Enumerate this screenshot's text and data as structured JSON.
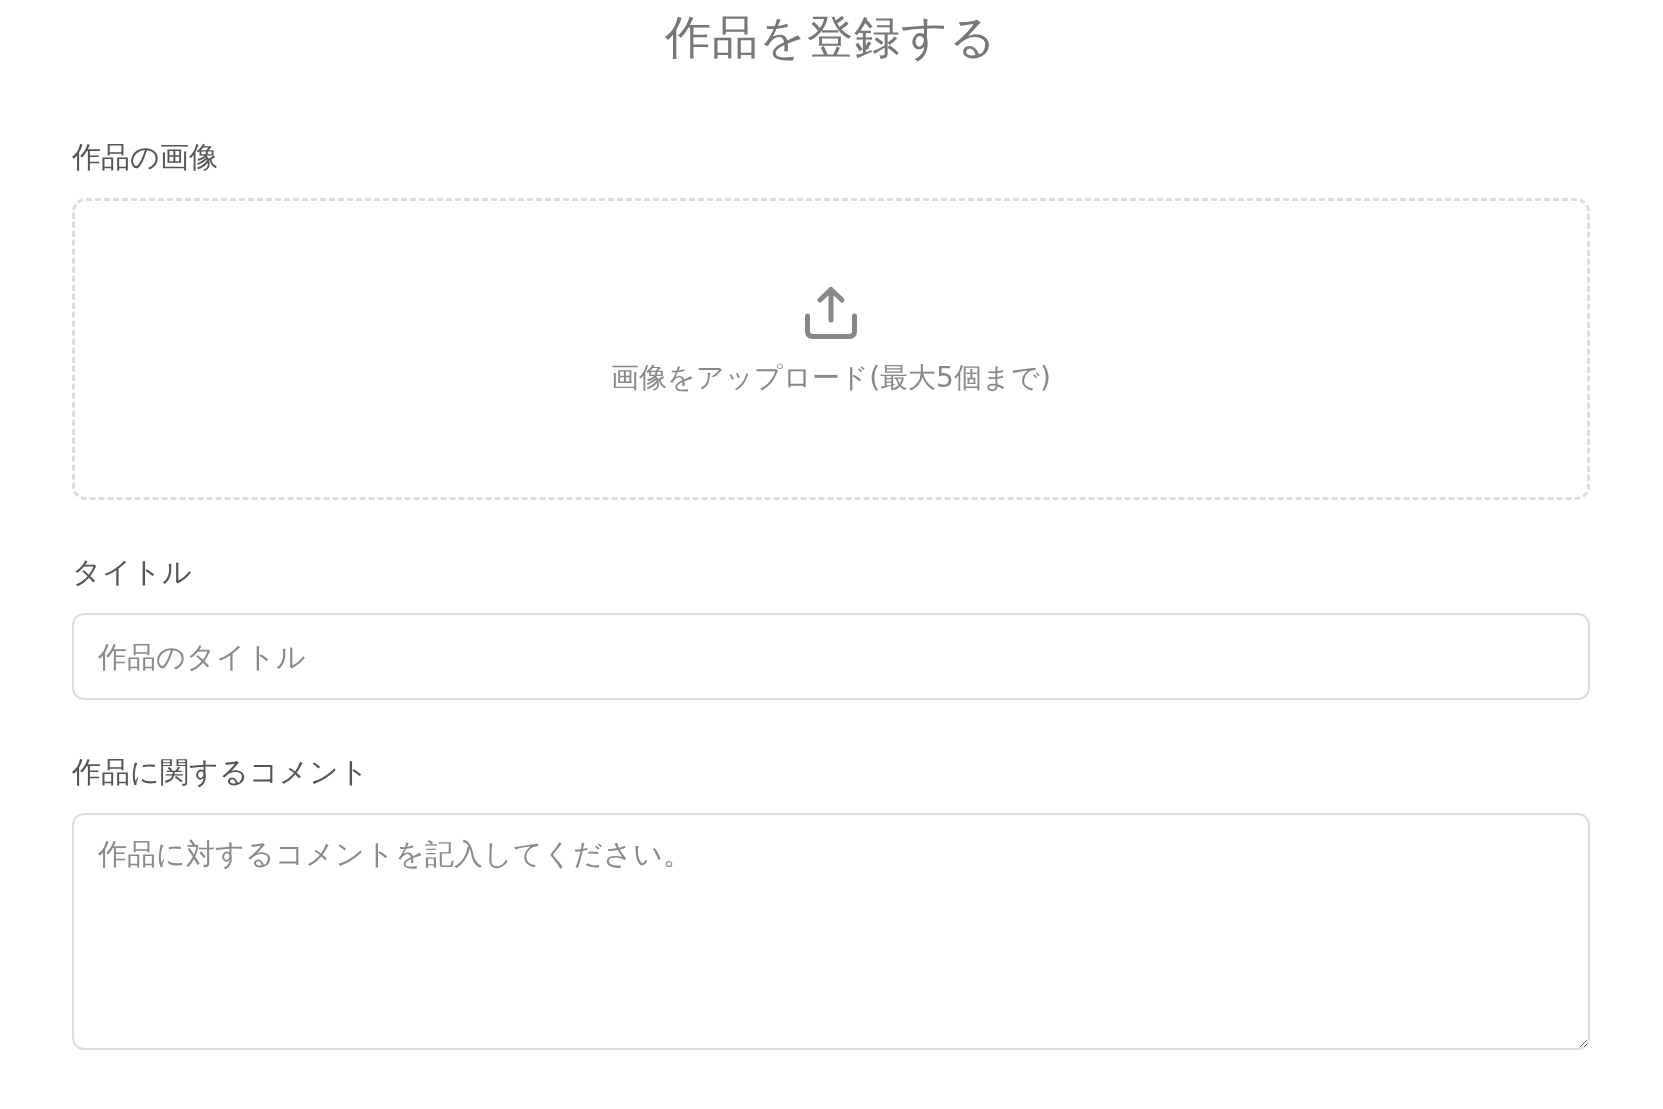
{
  "page": {
    "title": "作品を登録する"
  },
  "form": {
    "fields": [
      {
        "kind": "dropzone",
        "label": "作品の画像",
        "prompt": "画像をアップロード(最大5個まで)"
      },
      {
        "kind": "text",
        "label": "タイトル",
        "placeholder": "作品のタイトル"
      },
      {
        "kind": "textarea",
        "label": "作品に関するコメント",
        "placeholder": "作品に対するコメントを記入してください。"
      }
    ]
  }
}
